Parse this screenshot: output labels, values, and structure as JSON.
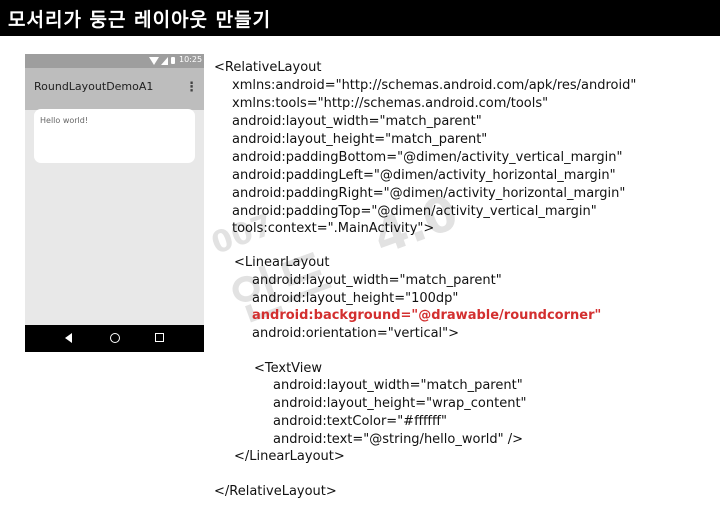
{
  "slide": {
    "title": "모서리가 둥근 레이아웃 만들기"
  },
  "phone": {
    "status": {
      "time": "10:25",
      "wifi_icon": "wifi-icon",
      "signal_icon": "signal-icon",
      "battery_icon": "battery-icon"
    },
    "app_title": "RoundLayoutDemoA1",
    "overflow_icon": "overflow-menu-icon",
    "card_text": "Hello world!",
    "nav": {
      "back_icon": "back-icon",
      "home_icon": "home-icon",
      "recents_icon": "recents-icon"
    }
  },
  "watermark": {
    "lines": [
      "007",
      "안드",
      "4.0"
    ],
    "color": "#cccccc"
  },
  "code": {
    "highlight_color": "#d32f2f",
    "lines": [
      "<RelativeLayout",
      "xmlns:android=\"http://schemas.android.com/apk/res/android\"",
      "xmlns:tools=\"http://schemas.android.com/tools\"",
      "android:layout_width=\"match_parent\"",
      "android:layout_height=\"match_parent\"",
      "android:paddingBottom=\"@dimen/activity_vertical_margin\"",
      "android:paddingLeft=\"@dimen/activity_horizontal_margin\"",
      "android:paddingRight=\"@dimen/activity_horizontal_margin\"",
      "android:paddingTop=\"@dimen/activity_vertical_margin\"",
      "tools:context=\".MainActivity\">",
      "<LinearLayout",
      "android:layout_width=\"match_parent\"",
      "android:layout_height=\"100dp\"",
      "android:background=\"@drawable/roundcorner\"",
      "android:orientation=\"vertical\">",
      "<TextView",
      "android:layout_width=\"match_parent\"",
      "android:layout_height=\"wrap_content\"",
      "android:textColor=\"#ffffff\"",
      "android:text=\"@string/hello_world\" />",
      "</LinearLayout>",
      "</RelativeLayout>"
    ]
  }
}
